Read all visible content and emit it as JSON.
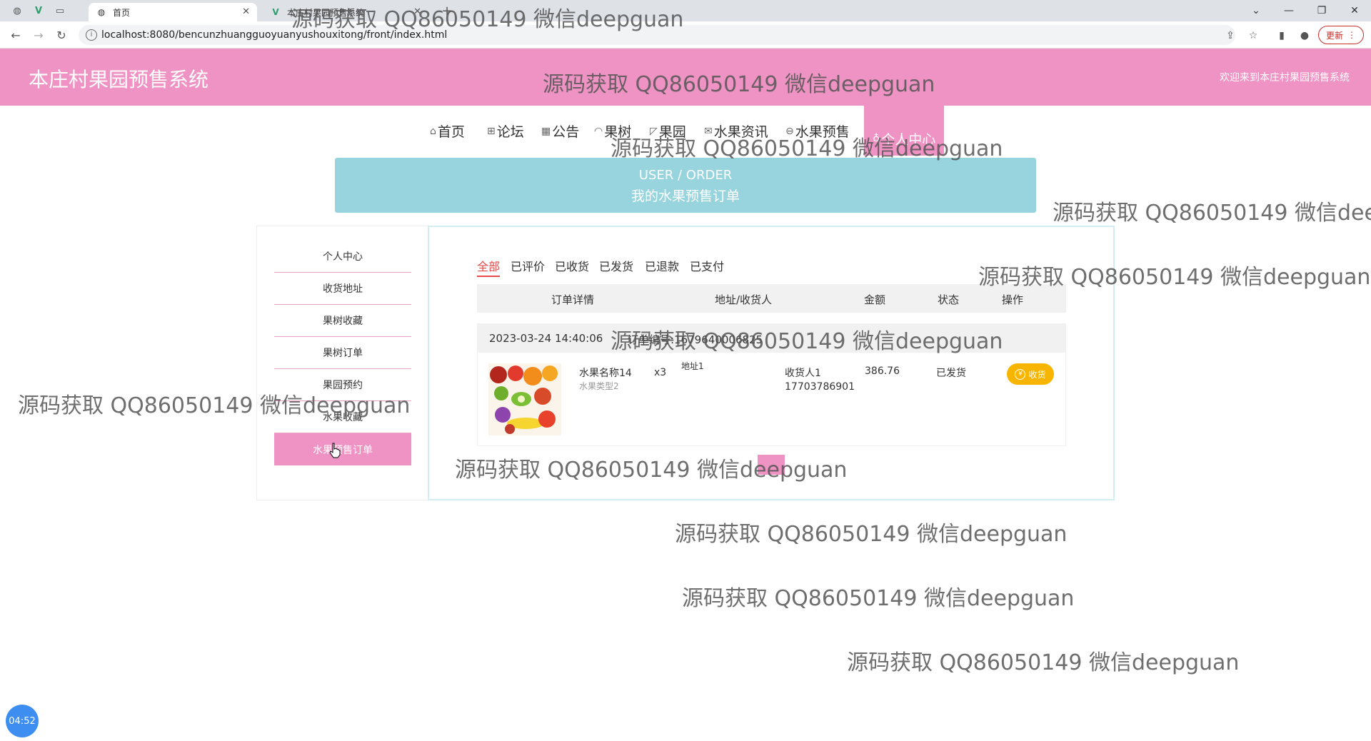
{
  "browser": {
    "tabs": [
      {
        "label": "首页",
        "active": true
      },
      {
        "label": "本庄村果园预售系统",
        "active": false
      }
    ],
    "url": "localhost:8080/bencunzhuangguoyuanyushouxitong/front/index.html",
    "update_label": "更新"
  },
  "header": {
    "title": "本庄村果园预售系统",
    "welcome": "欢迎来到本庄村果园预售系统"
  },
  "nav": {
    "items": [
      {
        "label": "首页",
        "icon": "home-icon"
      },
      {
        "label": "论坛",
        "icon": "forum-icon"
      },
      {
        "label": "公告",
        "icon": "notice-icon"
      },
      {
        "label": "果树",
        "icon": "tree-icon"
      },
      {
        "label": "果园",
        "icon": "orchard-icon"
      },
      {
        "label": "水果资讯",
        "icon": "mail-icon"
      },
      {
        "label": "水果预售",
        "icon": "presale-icon"
      },
      {
        "label": "个人中心",
        "icon": "user-icon"
      }
    ]
  },
  "banner": {
    "en": "USER / ORDER",
    "cn": "我的水果预售订单"
  },
  "sidebar": {
    "items": [
      {
        "label": "个人中心"
      },
      {
        "label": "收货地址"
      },
      {
        "label": "果树收藏"
      },
      {
        "label": "果树订单"
      },
      {
        "label": "果园预约"
      },
      {
        "label": "水果收藏"
      },
      {
        "label": "水果预售订单"
      }
    ]
  },
  "orders": {
    "tabs": [
      "全部",
      "已评价",
      "已收货",
      "已发货",
      "已退款",
      "已支付"
    ],
    "columns": [
      "订单详情",
      "地址/收货人",
      "金额",
      "状态",
      "操作"
    ],
    "list": [
      {
        "time": "2023-03-24 14:40:06",
        "order_no": "订单编号:1679640006825",
        "product_name": "水果名称14",
        "product_type": "水果类型2",
        "quantity": "x3",
        "address": "地址1",
        "receiver": "收货人1",
        "phone": "17703786901",
        "amount": "386.76",
        "status": "已发货",
        "action": "收货"
      }
    ]
  },
  "watermark": "源码获取 QQ86050149 微信deepguan",
  "timer": "04:52",
  "colors": {
    "header_pink": "#ee93c3",
    "banner_teal": "#97d4de",
    "receive_yellow": "#f7b500",
    "active_tab_red": "#e64a4a"
  }
}
